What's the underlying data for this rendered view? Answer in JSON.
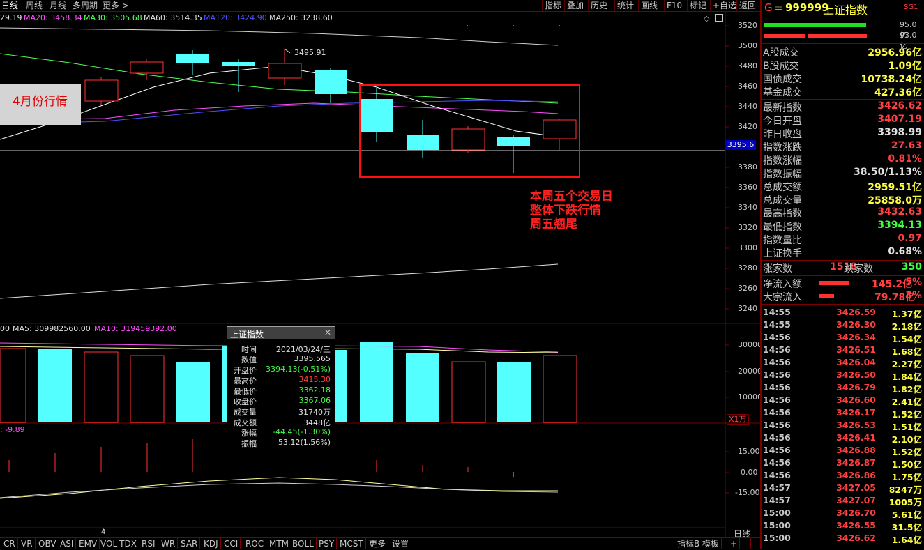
{
  "toolbar": {
    "tabs": [
      "日线",
      "周线",
      "月线",
      "多周期",
      "更多 >"
    ],
    "right_buttons": [
      "指标",
      "叠加",
      "历史",
      "统计",
      "画线",
      "F10",
      "标记",
      "+自选",
      "返回"
    ]
  },
  "ma_legend": {
    "prefix": "29.19",
    "ma20": "MA20: 3458.34",
    "ma30": "MA30: 3505.68",
    "ma60": "MA60: 3514.35",
    "ma120": "MA120: 3424.90",
    "ma250": "MA250: 3238.60"
  },
  "main_axis": [
    "3520",
    "3500",
    "3480",
    "3460",
    "3440",
    "3420",
    "3380",
    "3360",
    "3340",
    "3320",
    "3300",
    "3280",
    "3260",
    "3240"
  ],
  "current_price_tag": "3395.6",
  "peak_label": "3495.91",
  "annotations": {
    "april": "4月份行情",
    "week_line1": "本周五个交易日",
    "week_line2": "整体下跌行情",
    "week_line3": "周五翘尾"
  },
  "volume_legend": {
    "prefix": "00",
    "ma5": "MA5: 309982560.00",
    "ma10": "MA10: 319459392.00"
  },
  "volume_axis": [
    "30000",
    "20000",
    "10000"
  ],
  "volume_unit": "X1万",
  "indicator_legend": ": -9.89",
  "indicator_axis": [
    "15.00",
    "0.00",
    "-15.00"
  ],
  "period_label": "日线",
  "x_tick": "4",
  "tooltip": {
    "title": "上证指数",
    "rows": [
      {
        "k": "时间",
        "v": "2021/03/24/三",
        "c": "#e0e0e0"
      },
      {
        "k": "数值",
        "v": "3395.565",
        "c": "#e0e0e0"
      },
      {
        "k": "开盘价",
        "v": "3394.13(-0.51%)",
        "c": "#40ff40"
      },
      {
        "k": "最高价",
        "v": "3415.30",
        "c": "#ff4040"
      },
      {
        "k": "最低价",
        "v": "3362.18",
        "c": "#40ff40"
      },
      {
        "k": "收盘价",
        "v": "3367.06",
        "c": "#40ff40"
      },
      {
        "k": "成交量",
        "v": "31740万",
        "c": "#e0e0e0"
      },
      {
        "k": "成交额",
        "v": "3448亿",
        "c": "#e0e0e0"
      },
      {
        "k": "涨幅",
        "v": "-44.45(-1.30%)",
        "c": "#40ff40"
      },
      {
        "k": "振幅",
        "v": "53.12(1.56%)",
        "c": "#e0e0e0"
      }
    ]
  },
  "bottom_tabs": [
    "CR",
    "VR",
    "OBV",
    "ASI",
    "EMV",
    "VOL-TDX",
    "RSI",
    "WR",
    "SAR",
    "KDJ",
    "CCI",
    "ROC",
    "MTM",
    "BOLL",
    "PSY",
    "MCST",
    "更多",
    "设置"
  ],
  "bottom_right": [
    "指标B",
    "模板",
    "+",
    "-"
  ],
  "panel": {
    "header_g": "G",
    "header_code": "999999",
    "header_name": "上证指数",
    "header_badge": "SG1",
    "bar1_val": "95.0亿",
    "bar2_val": "93.0亿",
    "turnover": [
      {
        "k": "A股成交",
        "v": "2956.96亿"
      },
      {
        "k": "B股成交",
        "v": "1.09亿"
      },
      {
        "k": "国债成交",
        "v": "10738.24亿"
      },
      {
        "k": "基金成交",
        "v": "427.36亿"
      }
    ],
    "quote": [
      {
        "k": "最新指数",
        "v": "3426.62",
        "c": "#ff4040"
      },
      {
        "k": "今日开盘",
        "v": "3407.19",
        "c": "#ff4040"
      },
      {
        "k": "昨日收盘",
        "v": "3398.99",
        "c": "#e0e0e0"
      },
      {
        "k": "指数涨跌",
        "v": "27.63",
        "c": "#ff4040"
      },
      {
        "k": "指数涨幅",
        "v": "0.81%",
        "c": "#ff4040"
      },
      {
        "k": "指数振幅",
        "v": "38.50/1.13%",
        "c": "#e0e0e0"
      },
      {
        "k": "总成交额",
        "v": "2959.51亿",
        "c": "#ffff40"
      },
      {
        "k": "总成交量",
        "v": "25858.0万",
        "c": "#ffff40"
      },
      {
        "k": "最高指数",
        "v": "3432.63",
        "c": "#ff4040"
      },
      {
        "k": "最低指数",
        "v": "3394.13",
        "c": "#40ff40"
      },
      {
        "k": "指数量比",
        "v": "0.97",
        "c": "#ff4040"
      },
      {
        "k": "上证换手",
        "v": "0.68%",
        "c": "#e0e0e0"
      }
    ],
    "up_label": "涨家数",
    "up_val": "1518",
    "down_label": "跌家数",
    "down_val": "350",
    "flow": [
      {
        "k": "净流入额",
        "v": "145.2亿",
        "pct": "5%"
      },
      {
        "k": "大宗流入",
        "v": "79.78亿",
        "pct": "3%"
      }
    ],
    "ticks": [
      {
        "t": "14:55",
        "p": "3426.59",
        "v": "1.37亿"
      },
      {
        "t": "14:55",
        "p": "3426.30",
        "v": "2.18亿"
      },
      {
        "t": "14:56",
        "p": "3426.34",
        "v": "1.54亿"
      },
      {
        "t": "14:56",
        "p": "3426.51",
        "v": "1.68亿"
      },
      {
        "t": "14:56",
        "p": "3426.04",
        "v": "2.27亿"
      },
      {
        "t": "14:56",
        "p": "3426.50",
        "v": "1.84亿"
      },
      {
        "t": "14:56",
        "p": "3426.79",
        "v": "1.82亿"
      },
      {
        "t": "14:56",
        "p": "3426.60",
        "v": "2.41亿"
      },
      {
        "t": "14:56",
        "p": "3426.17",
        "v": "1.52亿"
      },
      {
        "t": "14:56",
        "p": "3426.53",
        "v": "1.51亿"
      },
      {
        "t": "14:56",
        "p": "3426.41",
        "v": "2.10亿"
      },
      {
        "t": "14:56",
        "p": "3426.88",
        "v": "1.52亿"
      },
      {
        "t": "14:56",
        "p": "3426.87",
        "v": "1.50亿"
      },
      {
        "t": "14:56",
        "p": "3426.86",
        "v": "1.75亿"
      },
      {
        "t": "14:57",
        "p": "3427.05",
        "v": "8247万"
      },
      {
        "t": "14:57",
        "p": "3427.07",
        "v": "1005万"
      },
      {
        "t": "15:00",
        "p": "3426.70",
        "v": "5.61亿"
      },
      {
        "t": "15:00",
        "p": "3426.55",
        "v": "31.5亿"
      },
      {
        "t": "15:00",
        "p": "3426.62",
        "v": "1.64亿"
      }
    ]
  },
  "colors": {
    "up": "#ff3232",
    "down": "#54ffff",
    "bg": "#000000",
    "grid": "#7a0000"
  }
}
